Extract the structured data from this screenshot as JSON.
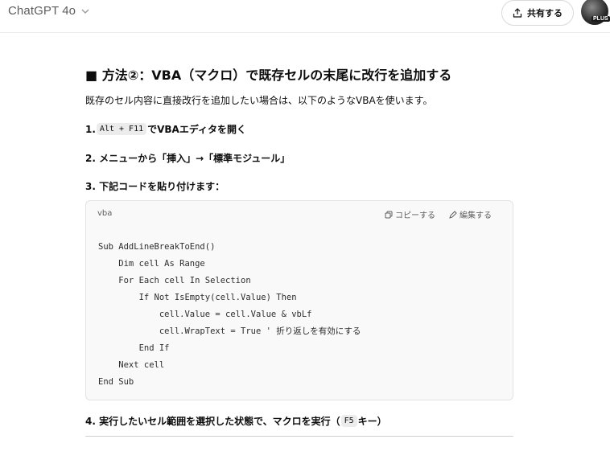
{
  "header": {
    "model_name": "ChatGPT 4o",
    "share_label": "共有する",
    "avatar_badge": "PLUS"
  },
  "message": {
    "heading": "■ 方法②：VBA（マクロ）で既存セルの末尾に改行を追加する",
    "intro": "既存のセル内容に直接改行を追加したい場合は、以下のようなVBAを使います。",
    "step1": {
      "prefix": "1. ",
      "key": "Alt + F11",
      "text": "でVBAエディタを開く"
    },
    "step2": {
      "text": "2. メニューから「挿入」→「標準モジュール」"
    },
    "step3": {
      "text": "3. 下記コードを貼り付けます："
    },
    "step4": {
      "prefix": "4. 実行したいセル範囲を選択した状態で、マクロを実行（",
      "key": "F5",
      "suffix": "キー）"
    }
  },
  "code_block": {
    "language": "vba",
    "copy_label": "コピーする",
    "edit_label": "編集する",
    "lines": [
      "Sub AddLineBreakToEnd()",
      "    Dim cell As Range",
      "    For Each cell In Selection",
      "        If Not IsEmpty(cell.Value) Then",
      "            cell.Value = cell.Value & vbLf",
      "            cell.WrapText = True ' 折り返しを有効にする",
      "        End If",
      "    Next cell",
      "End Sub"
    ]
  }
}
